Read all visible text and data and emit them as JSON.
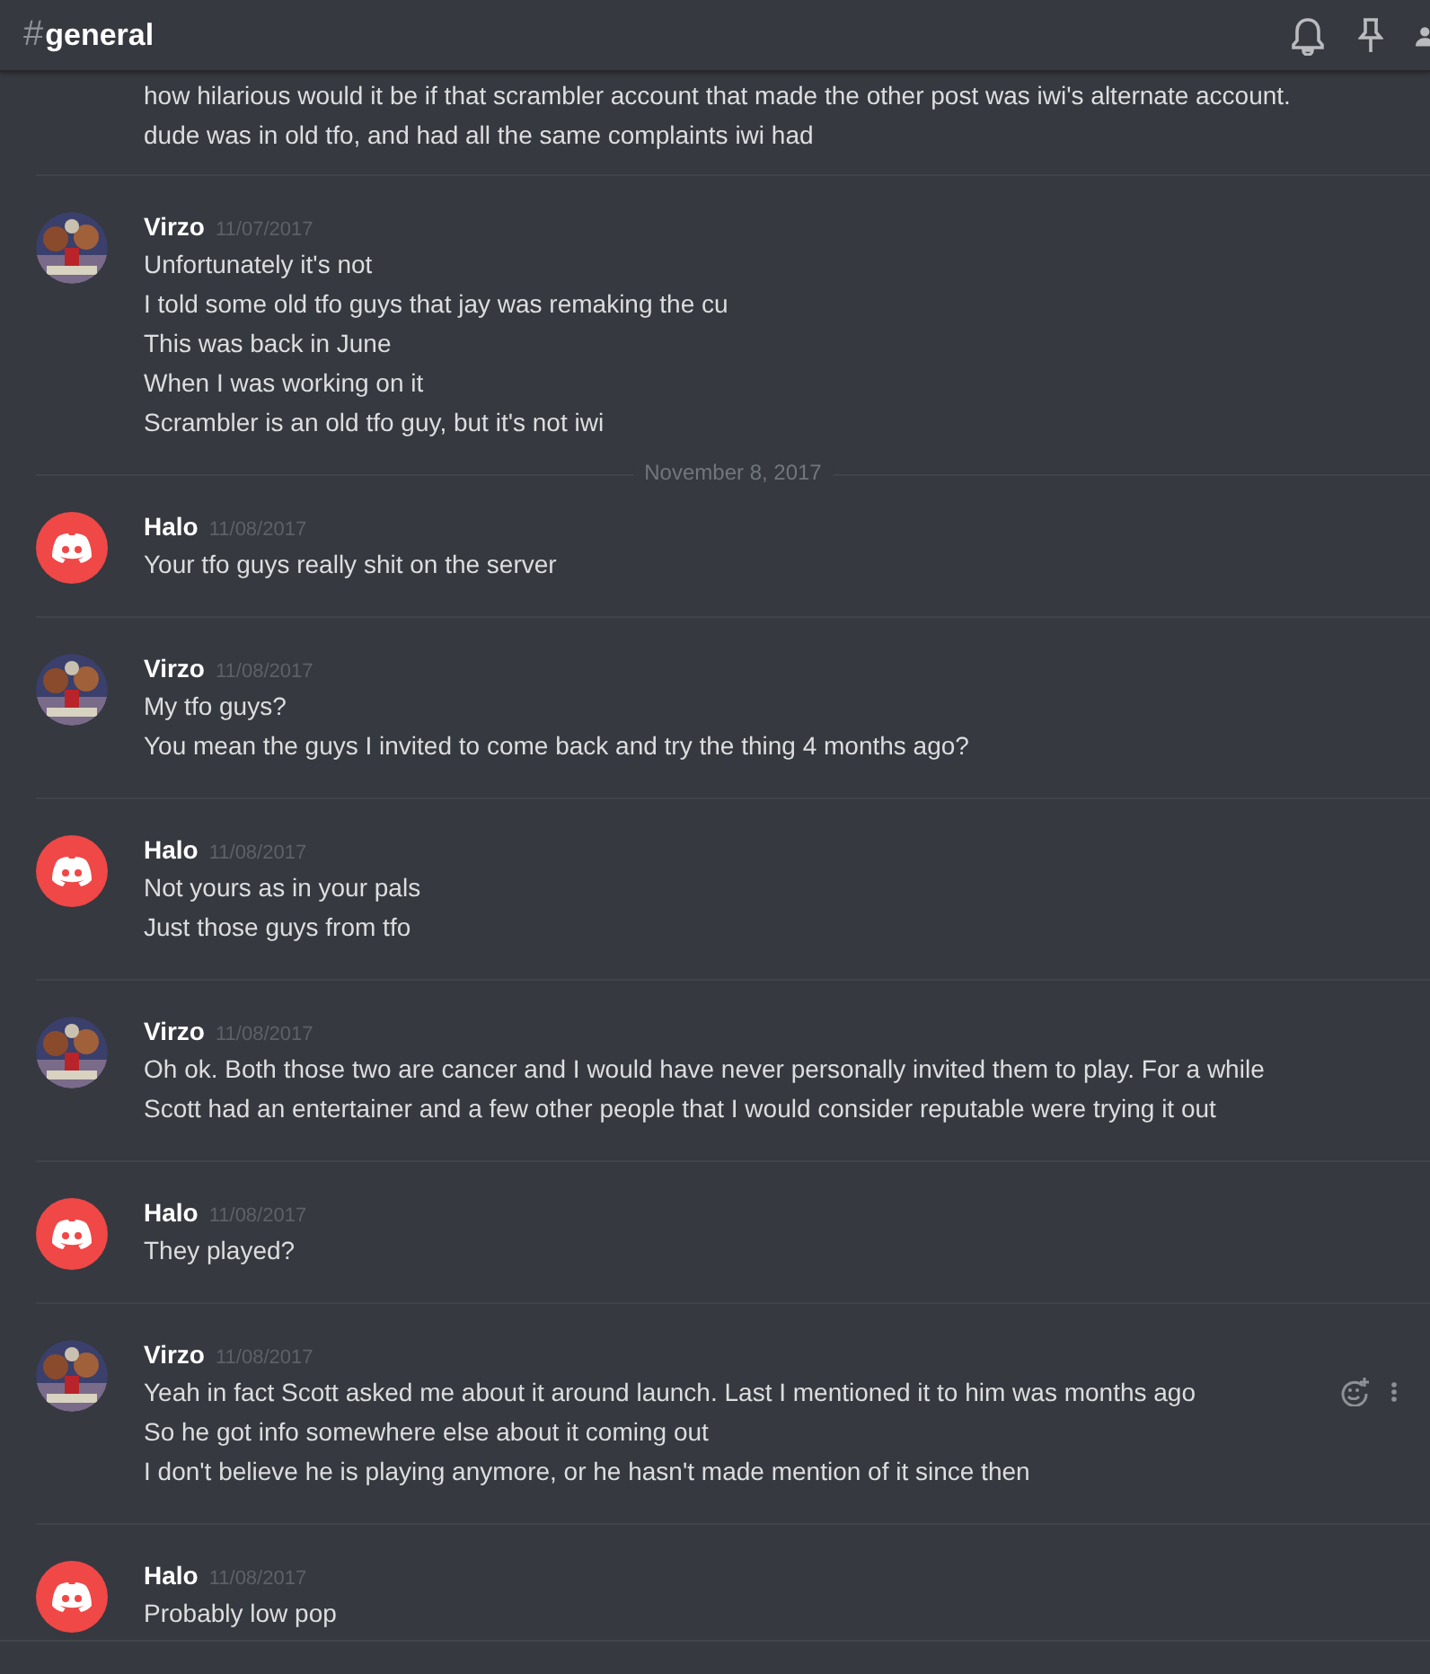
{
  "channel": {
    "hash": "#",
    "name": "general"
  },
  "items": [
    {
      "kind": "message",
      "continuation": true,
      "lines": [
        "how hilarious would it be if that scrambler account that made the other post was iwi's alternate account.",
        "dude was in old tfo, and had all the same complaints iwi had"
      ]
    },
    {
      "kind": "message",
      "author": "Virzo",
      "default_avatar": false,
      "time": "11/07/2017",
      "show_actions": false,
      "lines": [
        "Unfortunately it's not",
        "I told some old tfo guys that jay was remaking the cu",
        "This was back in June",
        "When I was working on it",
        "Scrambler is an old tfo guy, but it's not iwi"
      ]
    },
    {
      "kind": "date",
      "label": "November 8, 2017"
    },
    {
      "kind": "message",
      "author": "Halo",
      "default_avatar": true,
      "time": "11/08/2017",
      "show_actions": false,
      "lines": [
        "Your tfo guys really shit on the server"
      ]
    },
    {
      "kind": "message",
      "author": "Virzo",
      "default_avatar": false,
      "time": "11/08/2017",
      "show_actions": false,
      "lines": [
        "My tfo guys?",
        "You mean the guys I invited to come back and try the thing 4 months ago?"
      ]
    },
    {
      "kind": "message",
      "author": "Halo",
      "default_avatar": true,
      "time": "11/08/2017",
      "show_actions": false,
      "lines": [
        "Not yours as in your pals",
        "Just those guys from tfo"
      ]
    },
    {
      "kind": "message",
      "author": "Virzo",
      "default_avatar": false,
      "time": "11/08/2017",
      "show_actions": false,
      "lines": [
        "Oh ok. Both those two are cancer and I would have never personally invited them to play. For a while Scott had an entertainer and a few other people that I would consider reputable were trying it out"
      ]
    },
    {
      "kind": "message",
      "author": "Halo",
      "default_avatar": true,
      "time": "11/08/2017",
      "show_actions": false,
      "lines": [
        "They played?"
      ]
    },
    {
      "kind": "message",
      "author": "Virzo",
      "default_avatar": false,
      "time": "11/08/2017",
      "show_actions": true,
      "lines": [
        "Yeah in fact Scott asked me about it around launch. Last I mentioned it to him was months ago",
        "So he got info somewhere else about it coming out",
        "I don't believe he is playing anymore, or he hasn't made mention of it since then"
      ]
    },
    {
      "kind": "message",
      "author": "Halo",
      "default_avatar": true,
      "time": "11/08/2017",
      "show_actions": false,
      "lines": [
        "Probably low pop"
      ]
    }
  ]
}
